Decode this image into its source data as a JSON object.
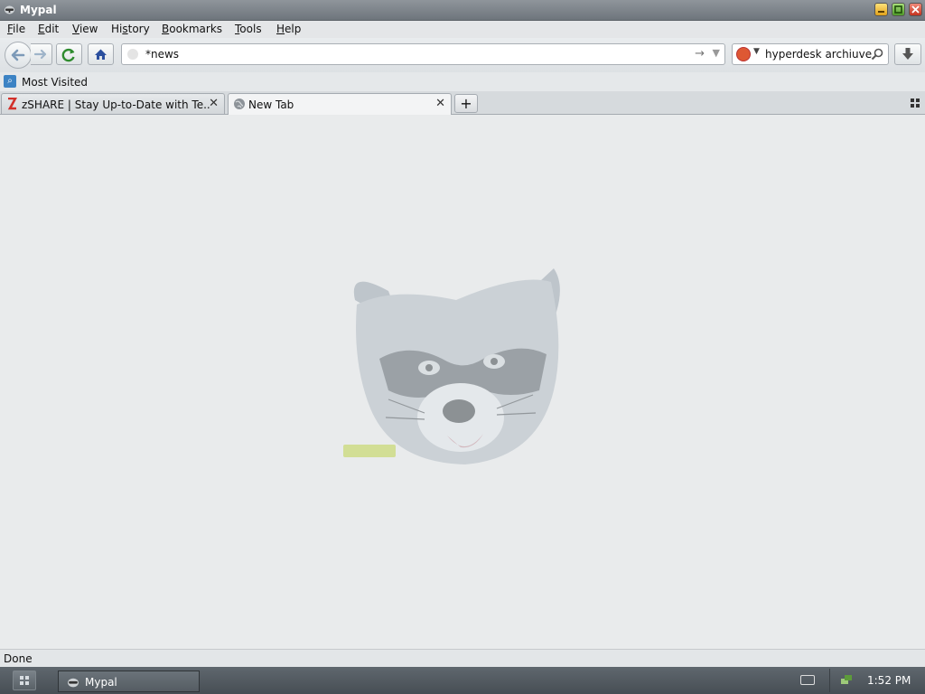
{
  "window": {
    "title": "Mypal",
    "icon": "raccoon-icon"
  },
  "menubar": {
    "items": [
      {
        "label": "File",
        "mnemonic": "F"
      },
      {
        "label": "Edit",
        "mnemonic": "E"
      },
      {
        "label": "View",
        "mnemonic": "V"
      },
      {
        "label": "History",
        "mnemonic": "s"
      },
      {
        "label": "Bookmarks",
        "mnemonic": "B"
      },
      {
        "label": "Tools",
        "mnemonic": "T"
      },
      {
        "label": "Help",
        "mnemonic": "H"
      }
    ]
  },
  "navbar": {
    "url": "*news",
    "search_query": "hyperdesk archiuve",
    "search_engine_icon": "duckduckgo-icon"
  },
  "bookmarks": {
    "label": "Most Visited"
  },
  "tabs": [
    {
      "label": "zSHARE | Stay Up-to-Date with Te...",
      "favicon": "zshare-icon",
      "active": false
    },
    {
      "label": "New Tab",
      "favicon": "globe-icon",
      "active": true
    }
  ],
  "content": {
    "image": "raccoon-logo"
  },
  "status": {
    "text": "Done"
  },
  "taskbar": {
    "task_label": "Mypal",
    "clock": "1:52 PM"
  },
  "colors": {
    "accent": "#3c83c4",
    "close": "#c3331e",
    "reload": "#2e8b2e",
    "home": "#2b4f9e"
  }
}
